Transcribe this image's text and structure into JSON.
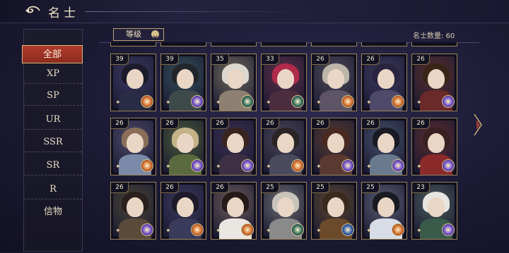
{
  "header": {
    "title": "名士"
  },
  "sort": {
    "label": "等级"
  },
  "count_text": "名士数量: 60",
  "sidebar": {
    "items": [
      {
        "label": "全部",
        "active": true
      },
      {
        "label": "XP"
      },
      {
        "label": "SP"
      },
      {
        "label": "UR"
      },
      {
        "label": "SSR"
      },
      {
        "label": "SR"
      },
      {
        "label": "R"
      },
      {
        "label": "信物"
      }
    ]
  },
  "cards": [
    {
      "level": "39",
      "hair": "#1d1b2a",
      "body": "#2a2b44",
      "bg": "#3b3a63",
      "badge": "#d26a2a"
    },
    {
      "level": "39",
      "hair": "#22262a",
      "body": "#3e4a4a",
      "bg": "#33505a",
      "badge": "#6b4ac9"
    },
    {
      "level": "35",
      "hair": "#dcd8d0",
      "body": "#8d8070",
      "bg": "#6f6a5e",
      "badge": "#2e6a5a"
    },
    {
      "level": "33",
      "hair": "#b02a4a",
      "body": "#4b2d3e",
      "bg": "#5a3048",
      "badge": "#2e6a5a"
    },
    {
      "level": "26",
      "hair": "#bcb6a8",
      "body": "#5d5466",
      "bg": "#4f4a5a",
      "badge": "#d26a2a"
    },
    {
      "level": "26",
      "hair": "#2a2440",
      "body": "#504a6a",
      "bg": "#3d3a5e",
      "badge": "#d26a2a"
    },
    {
      "level": "26",
      "hair": "#3a2418",
      "body": "#6a2a2a",
      "bg": "#5a2f2f",
      "badge": "#6b4ac9"
    },
    {
      "level": "26",
      "hair": "#8a6e5a",
      "body": "#7a8aa8",
      "bg": "#4e4a6a",
      "badge": "#d26a2a"
    },
    {
      "level": "26",
      "hair": "#c4b288",
      "body": "#5a6a3e",
      "bg": "#4a5a3a",
      "badge": "#6b4ac9"
    },
    {
      "level": "26",
      "hair": "#3a2420",
      "body": "#3e3044",
      "bg": "#3a3050",
      "badge": "#6b4ac9"
    },
    {
      "level": "26",
      "hair": "#2a2424",
      "body": "#4a4a5e",
      "bg": "#4a4658",
      "badge": "#d26a2a"
    },
    {
      "level": "26",
      "hair": "#4a2a20",
      "body": "#5a3a30",
      "bg": "#553a32",
      "badge": "#6b4ac9"
    },
    {
      "level": "26",
      "hair": "#1a1a22",
      "body": "#6a7a8e",
      "bg": "#45506a",
      "badge": "#6b4ac9"
    },
    {
      "level": "26",
      "hair": "#3a2020",
      "body": "#8a2a2a",
      "bg": "#5a2c30",
      "badge": "#6b4ac9"
    },
    {
      "level": "26",
      "hair": "#2a201e",
      "body": "#5a4a3a",
      "bg": "#4a4538",
      "badge": "#6b4ac9"
    },
    {
      "level": "26",
      "hair": "#1e1a2a",
      "body": "#3a3a5a",
      "bg": "#3a3a5e",
      "badge": "#d26a2a"
    },
    {
      "level": "26",
      "hair": "#241a18",
      "body": "#eae6e2",
      "bg": "#6a5a5a",
      "badge": "#d26a2a"
    },
    {
      "level": "25",
      "hair": "#c8c4bc",
      "body": "#8a8a8a",
      "bg": "#6a6a70",
      "badge": "#2e6a5a"
    },
    {
      "level": "25",
      "hair": "#3a2a1e",
      "body": "#6a4a2a",
      "bg": "#5a4530",
      "badge": "#2e5aa8"
    },
    {
      "level": "25",
      "hair": "#1a1a20",
      "body": "#d8dce6",
      "bg": "#5a5e72",
      "badge": "#d26a2a"
    },
    {
      "level": "23",
      "hair": "#e8e4e0",
      "body": "#3a5a4a",
      "bg": "#4a5a5a",
      "badge": "#6b4ac9"
    }
  ]
}
